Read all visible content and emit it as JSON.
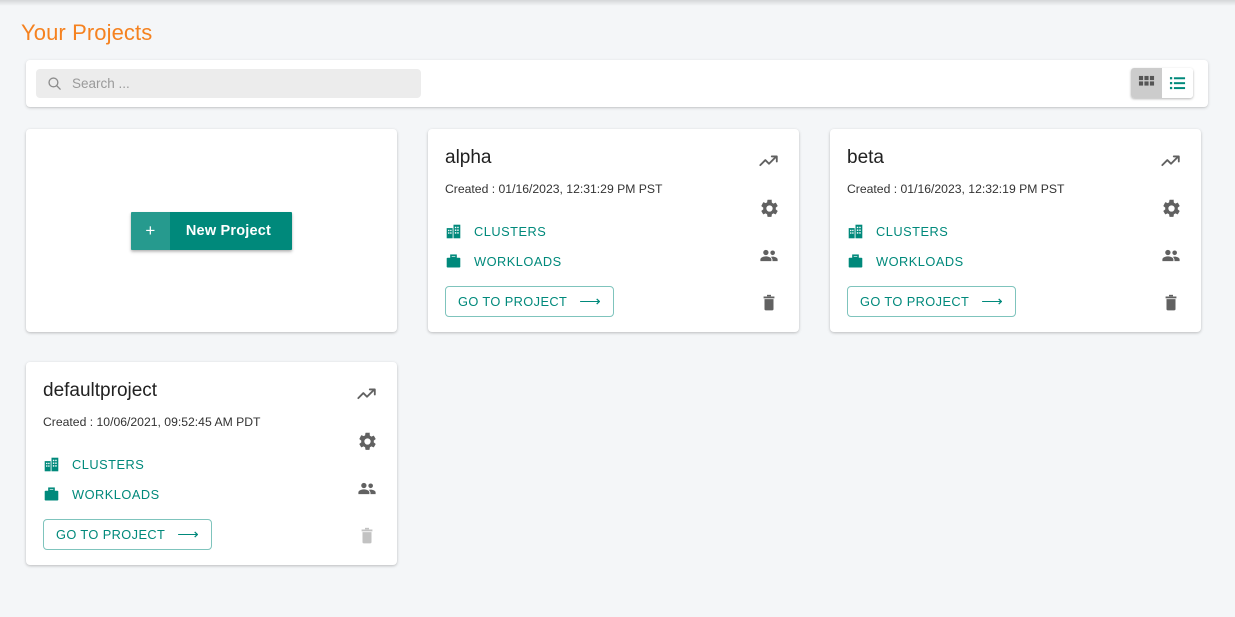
{
  "page": {
    "title": "Your Projects",
    "accent_orange": "#f58220",
    "accent_teal": "#00897b",
    "background": "#f4f6f8"
  },
  "search": {
    "placeholder": "Search ...",
    "value": "",
    "icon": "search-icon"
  },
  "view_toggle": {
    "grid": {
      "label": "Grid view",
      "icon": "grid-view-icon",
      "selected": true
    },
    "list": {
      "label": "List view",
      "icon": "list-view-icon",
      "selected": false
    }
  },
  "new_project": {
    "plus": "+",
    "label": "New Project"
  },
  "card_actions": {
    "clusters_label": "CLUSTERS",
    "workloads_label": "WORKLOADS",
    "goto_label": "GO TO PROJECT",
    "goto_arrow": "⟶",
    "clusters_icon": "building-icon",
    "workloads_icon": "briefcase-icon",
    "trend_icon": "trending-up-icon",
    "settings_icon": "gear-icon",
    "members_icon": "people-icon",
    "delete_icon": "trash-icon"
  },
  "created_prefix": "Created : ",
  "projects": [
    {
      "name": "alpha",
      "created": "Created :  01/16/2023, 12:31:29 PM PST",
      "delete_enabled": true
    },
    {
      "name": "beta",
      "created": "Created :  01/16/2023, 12:32:19 PM PST",
      "delete_enabled": true
    },
    {
      "name": "defaultproject",
      "created": "Created :  10/06/2021, 09:52:45 AM PDT",
      "delete_enabled": false
    }
  ]
}
